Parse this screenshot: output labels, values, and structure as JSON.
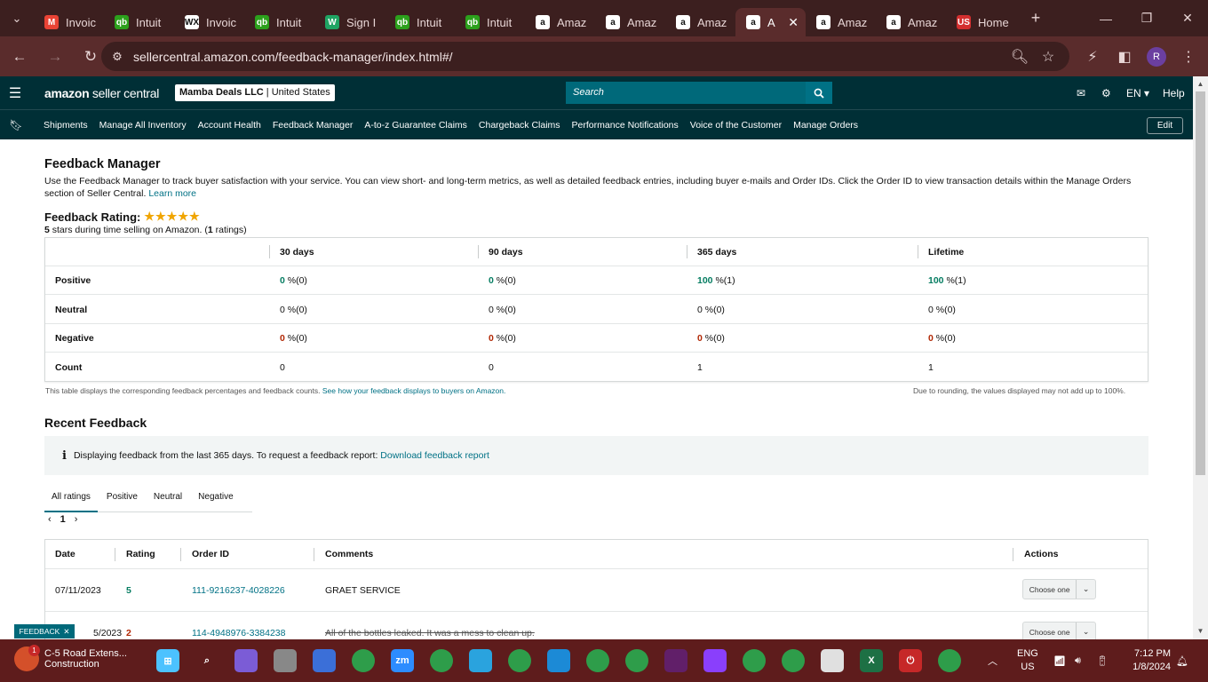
{
  "browser": {
    "tabs": [
      {
        "title": "Invoic",
        "icon": "gmail-icon",
        "color": "#ea4335",
        "glyph": "M"
      },
      {
        "title": "Intuit",
        "icon": "quickbooks-icon",
        "color": "#2ca01c",
        "glyph": "qb"
      },
      {
        "title": "Invoic",
        "icon": "wix-icon",
        "color": "#ffffff",
        "glyph": "WX"
      },
      {
        "title": "Intuit",
        "icon": "quickbooks-icon",
        "color": "#2ca01c",
        "glyph": "qb"
      },
      {
        "title": "Sign I",
        "icon": "w-icon",
        "color": "#1fa463",
        "glyph": "W"
      },
      {
        "title": "Intuit",
        "icon": "quickbooks-icon",
        "color": "#2ca01c",
        "glyph": "qb"
      },
      {
        "title": "Intuit",
        "icon": "quickbooks-icon",
        "color": "#2ca01c",
        "glyph": "qb"
      },
      {
        "title": "Amaz",
        "icon": "amazon-icon",
        "color": "#ffffff",
        "glyph": "a"
      },
      {
        "title": "Amaz",
        "icon": "amazon-icon",
        "color": "#ffffff",
        "glyph": "a"
      },
      {
        "title": "Amaz",
        "icon": "amazon-icon",
        "color": "#ffffff",
        "glyph": "a"
      },
      {
        "title": "A",
        "icon": "amazon-icon",
        "color": "#ffffff",
        "glyph": "a",
        "active": true
      },
      {
        "title": "Amaz",
        "icon": "amazon-icon",
        "color": "#ffffff",
        "glyph": "a"
      },
      {
        "title": "Amaz",
        "icon": "amazon-icon",
        "color": "#ffffff",
        "glyph": "a"
      },
      {
        "title": "Home",
        "icon": "us-flag-icon",
        "color": "#d32f2f",
        "glyph": "US"
      }
    ],
    "url": "sellercentral.amazon.com/feedback-manager/index.html#/"
  },
  "header": {
    "logo_main": "amazon",
    "logo_sub": "seller central",
    "account_name": "Mamba Deals LLC",
    "account_region": "United States",
    "search_placeholder": "Search",
    "language": "EN",
    "help": "Help"
  },
  "nav": {
    "links": [
      "Shipments",
      "Manage All Inventory",
      "Account Health",
      "Feedback Manager",
      "A-to-z Guarantee Claims",
      "Chargeback Claims",
      "Performance Notifications",
      "Voice of the Customer",
      "Manage Orders"
    ],
    "edit": "Edit"
  },
  "page": {
    "title": "Feedback Manager",
    "description": "Use the Feedback Manager to track buyer satisfaction with your service. You can view short- and long-term metrics, as well as detailed feedback entries, including buyer e-mails and Order IDs. Click the Order ID to view transaction details within the Manage Orders section of Seller Central.",
    "learn_more": "Learn more",
    "rating_title": "Feedback Rating:",
    "rating_stars": 5,
    "rating_sub_stars": "5",
    "rating_sub_mid": " stars during time selling on Amazon. (",
    "rating_sub_count": "1",
    "rating_sub_end": " ratings)"
  },
  "metrics": {
    "columns": [
      "30 days",
      "90 days",
      "365 days",
      "Lifetime"
    ],
    "rows": [
      {
        "label": "Positive",
        "values": [
          {
            "v": "0",
            "s": " %(0)",
            "tone": "green"
          },
          {
            "v": "0",
            "s": " %(0)",
            "tone": "green"
          },
          {
            "v": "100",
            "s": " %(1)",
            "tone": "green"
          },
          {
            "v": "100",
            "s": " %(1)",
            "tone": "green"
          }
        ]
      },
      {
        "label": "Neutral",
        "values": [
          {
            "v": "0",
            "s": " %(0)",
            "tone": "plain"
          },
          {
            "v": "0",
            "s": " %(0)",
            "tone": "plain"
          },
          {
            "v": "0",
            "s": " %(0)",
            "tone": "plain"
          },
          {
            "v": "0",
            "s": " %(0)",
            "tone": "plain"
          }
        ]
      },
      {
        "label": "Negative",
        "values": [
          {
            "v": "0",
            "s": " %(0)",
            "tone": "red"
          },
          {
            "v": "0",
            "s": " %(0)",
            "tone": "red"
          },
          {
            "v": "0",
            "s": " %(0)",
            "tone": "red"
          },
          {
            "v": "0",
            "s": " %(0)",
            "tone": "red"
          }
        ]
      },
      {
        "label": "Count",
        "values": [
          {
            "v": "0",
            "s": "",
            "tone": "plain"
          },
          {
            "v": "0",
            "s": "",
            "tone": "plain"
          },
          {
            "v": "1",
            "s": "",
            "tone": "plain"
          },
          {
            "v": "1",
            "s": "",
            "tone": "plain"
          }
        ]
      }
    ],
    "footnote_left": "This table displays the corresponding feedback percentages and feedback counts.",
    "footnote_link": "See how your feedback displays to buyers on Amazon.",
    "footnote_right": "Due to rounding, the values displayed may not add up to 100%."
  },
  "recent": {
    "title": "Recent Feedback",
    "info": "Displaying feedback from the last 365 days. To request a feedback report:",
    "info_link": "Download feedback report",
    "tabs": [
      "All ratings",
      "Positive",
      "Neutral",
      "Negative"
    ],
    "page": "1",
    "columns": [
      "Date",
      "Rating",
      "Order ID",
      "Comments",
      "Actions"
    ],
    "rows": [
      {
        "date": "07/11/2023",
        "rating": "5",
        "order": "111-9216237-4028226",
        "comment": "GRAET SERVICE",
        "action": "Choose one",
        "struck": false
      },
      {
        "date": "5/2023",
        "rating": "2",
        "order": "114-4948976-3384238",
        "comment": "All of the bottles leaked. It was a mess to clean up.",
        "action": "Choose one",
        "struck": true
      }
    ]
  },
  "feedback_tag": "FEEDBACK",
  "taskbar": {
    "news_title": "C-5 Road Extens...",
    "news_sub": "Construction",
    "news_badge": "1",
    "lang": "ENG",
    "region": "US",
    "time": "7:12 PM",
    "date": "1/8/2024"
  },
  "colors": {
    "accent": "#007185",
    "positive": "#067d62",
    "negative": "#b12704",
    "star": "#f0a500"
  }
}
